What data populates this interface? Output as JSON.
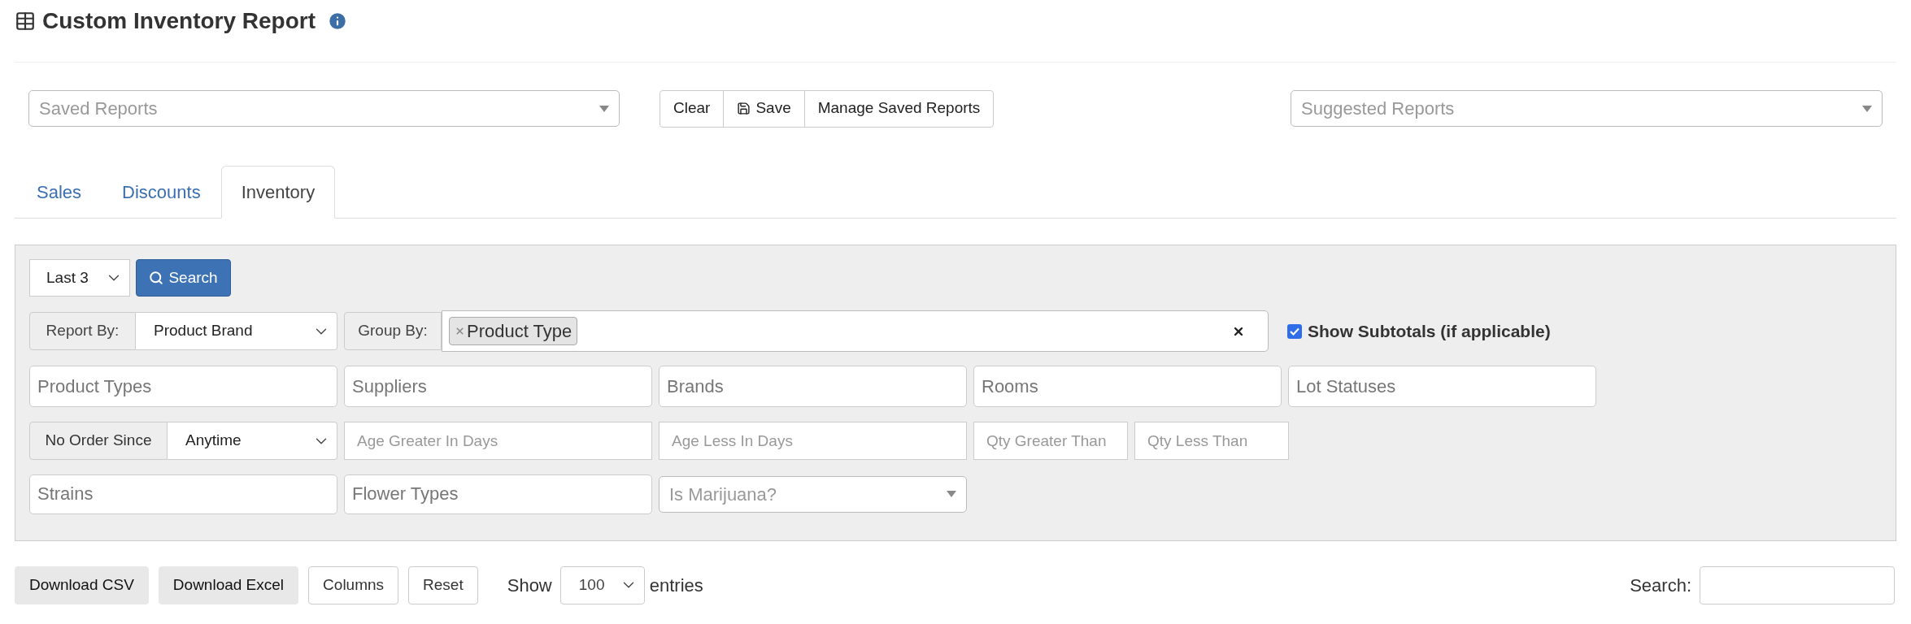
{
  "title": "Custom Inventory Report",
  "saved_reports": {
    "placeholder": "Saved Reports"
  },
  "report_buttons": [
    {
      "label": "Clear",
      "kind": "plain"
    },
    {
      "label": "Save",
      "kind": "save"
    },
    {
      "label": "Manage Saved Reports",
      "kind": "plain"
    }
  ],
  "suggested_reports": {
    "placeholder": "Suggested Reports"
  },
  "tabs": [
    {
      "label": "Sales",
      "selected": false
    },
    {
      "label": "Discounts",
      "selected": false
    },
    {
      "label": "Inventory",
      "selected": true
    }
  ],
  "filters": {
    "period": {
      "value": "Last 3"
    },
    "search_button": "Search",
    "report_by": {
      "label": "Report By:",
      "value": "Product Brand"
    },
    "group_by": {
      "label": "Group By:",
      "tags": [
        "Product Type"
      ]
    },
    "show_subtotals": {
      "label": "Show Subtotals (if applicable)",
      "checked": true
    },
    "multi_fields": [
      {
        "placeholder": "Product Types"
      },
      {
        "placeholder": "Suppliers"
      },
      {
        "placeholder": "Brands"
      },
      {
        "placeholder": "Rooms"
      },
      {
        "placeholder": "Lot Statuses"
      }
    ],
    "no_order_since": {
      "label": "No Order Since",
      "value": "Anytime"
    },
    "age_fields": [
      {
        "placeholder": "Age Greater In Days"
      },
      {
        "placeholder": "Age Less In Days"
      }
    ],
    "qty_fields": [
      {
        "placeholder": "Qty Greater Than"
      },
      {
        "placeholder": "Qty Less Than"
      }
    ],
    "extra_fields": [
      {
        "placeholder": "Strains"
      },
      {
        "placeholder": "Flower Types"
      }
    ],
    "is_marijuana": {
      "placeholder": "Is Marijuana?"
    }
  },
  "table_controls": {
    "buttons": [
      {
        "label": "Download CSV",
        "kind": "filled"
      },
      {
        "label": "Download Excel",
        "kind": "filled"
      },
      {
        "label": "Columns",
        "kind": "outline"
      },
      {
        "label": "Reset",
        "kind": "outline"
      }
    ],
    "show_label": "Show",
    "page_size": "100",
    "entries_label": "entries",
    "search_label": "Search:"
  }
}
